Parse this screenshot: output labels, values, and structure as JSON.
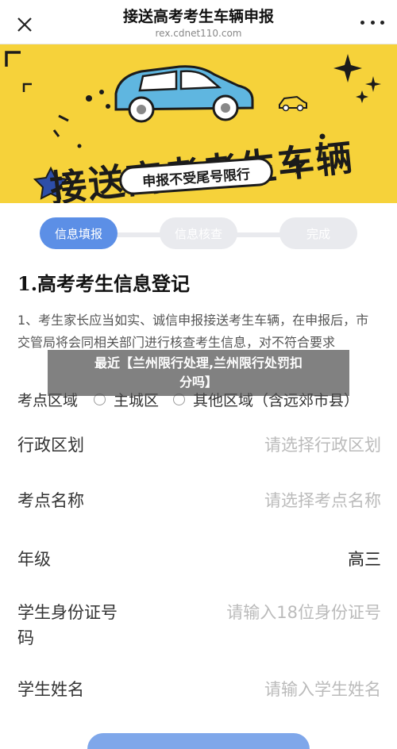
{
  "header": {
    "title": "接送高考考生车辆申报",
    "subtitle": "rex.cdnet110.com"
  },
  "banner": {
    "heading": "接送高考考生车辆",
    "tag": "申报不受尾号限行",
    "bg_color": "#f6d23a"
  },
  "steps": [
    {
      "label": "信息填报",
      "active": true
    },
    {
      "label": "信息核查",
      "active": false
    },
    {
      "label": "完成",
      "active": false
    }
  ],
  "form": {
    "section_title": "1.高考考生信息登记",
    "notice": "1、考生家长应当如实、诚信申报接送考生车辆，在申报后，市交管局将会同相关部门进行核查考生信息，对不符合要求",
    "exam_area": {
      "label": "考点区域",
      "options": [
        "主城区",
        "其他区域（含远郊市县）"
      ]
    },
    "fields": [
      {
        "label": "行政区划",
        "value": "请选择行政区划",
        "filled": false
      },
      {
        "label": "考点名称",
        "value": "请选择考点名称",
        "filled": false
      },
      {
        "label": "年级",
        "value": "高三",
        "filled": true
      },
      {
        "label_line1": "学生身份证号",
        "label_line2": "码",
        "value": "请输入18位身份证号",
        "filled": false
      },
      {
        "label": "学生姓名",
        "value": "请输入学生姓名",
        "filled": false
      }
    ]
  },
  "overlay": {
    "line1": "最近【兰州限行处理,兰州限行处罚扣",
    "line2": "分吗】"
  },
  "colors": {
    "accent": "#5c8fe6",
    "banner": "#f6d23a"
  }
}
